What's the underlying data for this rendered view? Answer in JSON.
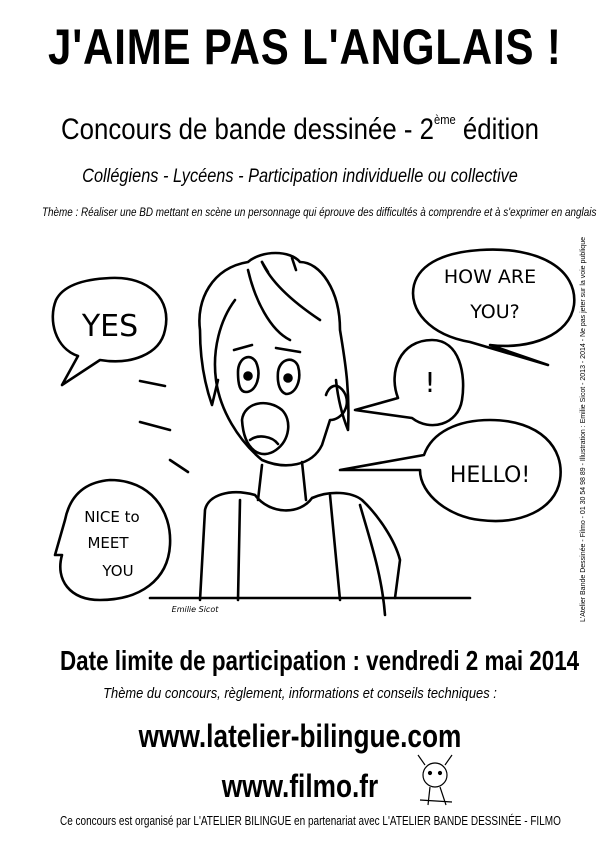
{
  "poster": {
    "title": "J'AIME PAS L'ANGLAIS !",
    "subtitle_main": "Concours de bande dessinée - 2",
    "subtitle_sup": "ème",
    "subtitle_end": " édition",
    "audience": "Collégiens - Lycéens - Participation individuelle ou collective",
    "theme": "Thème : Réaliser une BD mettant en scène un personnage qui éprouve des difficultés à comprendre et à s'exprimer en anglais",
    "deadline": "Date limite de participation : vendredi 2 mai 2014",
    "info": "Thème du concours, règlement, informations et conseils techniques :",
    "website1": "www.latelier-bilingue.com",
    "website2": "www.filmo.fr",
    "footer": "Ce concours est organisé par L'ATELIER BILINGUE en partenariat avec L'ATELIER BANDE DESSINÉE - FILMO",
    "credit": "L'Atelier Bande Dessinée - Filmo - 01 30 54 98 89 - Illustration : Emilie Sicot - 2013 - 2014 - Ne pas jeter sur la voie publique"
  },
  "bubbles": {
    "yes": "YES",
    "how1": "HOW ARE",
    "how2": "YOU?",
    "excl": "!",
    "hello": "HELLO!",
    "nice1": "NICE to",
    "nice2": "MEET",
    "nice3": "YOU"
  },
  "signature": "Emilie Sicot",
  "colors": {
    "ink": "#000000",
    "paper": "#ffffff"
  }
}
